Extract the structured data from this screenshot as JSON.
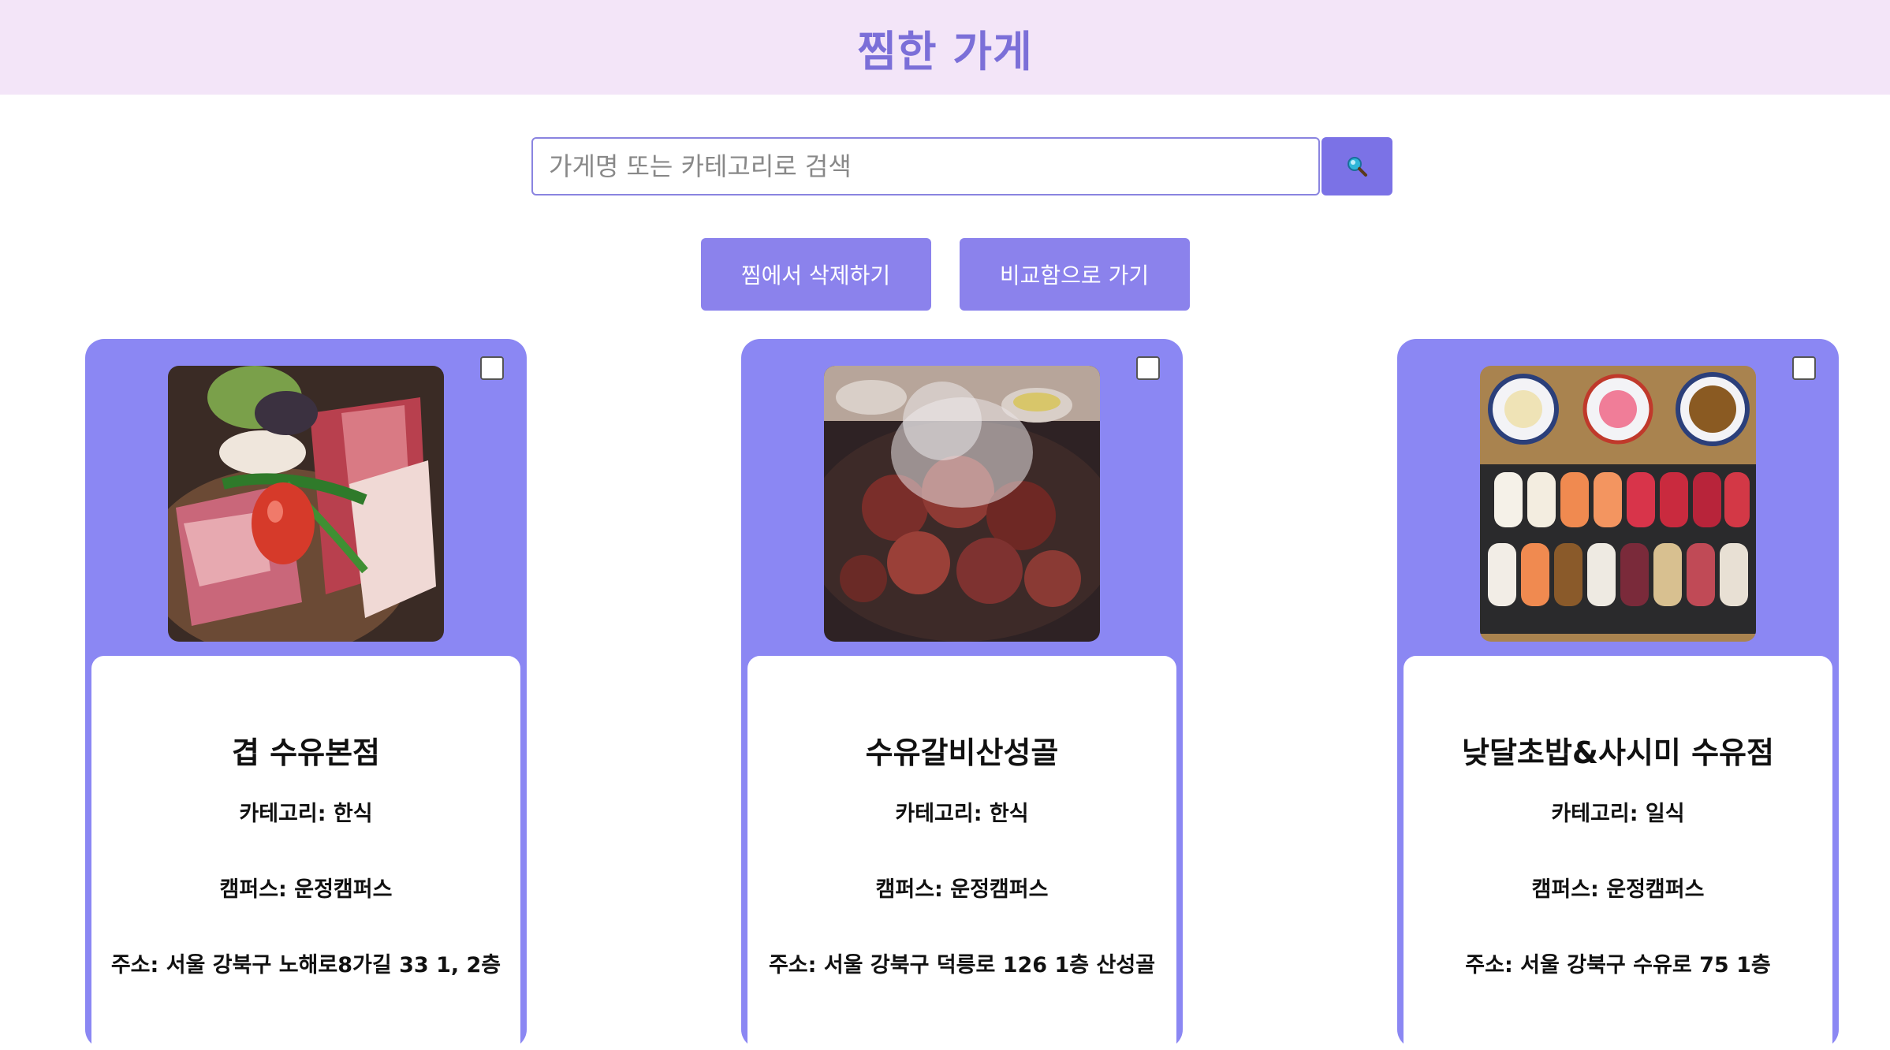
{
  "header": {
    "title": "찜한 가게"
  },
  "search": {
    "placeholder": "가게명 또는 카테고리로 검색",
    "button_icon": "magnifier-icon"
  },
  "actions": {
    "delete_label": "찜에서 삭제하기",
    "compare_label": "비교함으로 가기"
  },
  "colors": {
    "accent": "#8b87f3",
    "header_bg": "#f3e5f8",
    "title": "#7b6fd8"
  },
  "stores": [
    {
      "name": "겹 수유본점",
      "category": "카테고리: 한식",
      "campus": "캠퍼스: 운정캠퍼스",
      "address": "주소: 서울 강북구 노해로8가길 33 1, 2층",
      "checked": false
    },
    {
      "name": "수유갈비산성골",
      "category": "카테고리: 한식",
      "campus": "캠퍼스: 운정캠퍼스",
      "address": "주소: 서울 강북구 덕릉로 126 1층 산성골",
      "checked": false
    },
    {
      "name": "낮달초밥&사시미 수유점",
      "category": "카테고리: 일식",
      "campus": "캠퍼스: 운정캠퍼스",
      "address": "주소: 서울 강북구 수유로 75 1층",
      "checked": false
    }
  ]
}
